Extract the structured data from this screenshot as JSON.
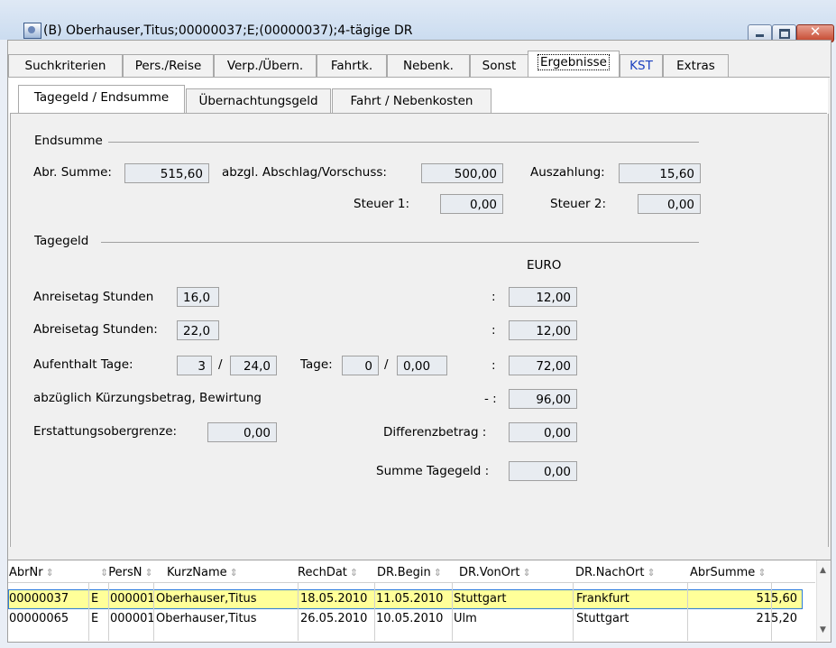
{
  "window": {
    "title": "(B) Oberhauser,Titus;00000037;E;(00000037);4-tägige DR"
  },
  "tabs": [
    "Suchkriterien",
    "Pers./Reise",
    "Verp./Übern.",
    "Fahrtk.",
    "Nebenk.",
    "Sonst",
    "Ergebnisse",
    "KST",
    "Extras"
  ],
  "active_tab": "Ergebnisse",
  "subtabs": [
    "Tagegeld / Endsumme",
    "Übernachtungsgeld",
    "Fahrt / Nebenkosten"
  ],
  "active_subtab": "Tagegeld / Endsumme",
  "endsumme": {
    "header": "Endsumme",
    "abr_summe_label": "Abr. Summe:",
    "abr_summe": "515,60",
    "abschlag_label": "abzgl. Abschlag/Vorschuss:",
    "abschlag": "500,00",
    "auszahlung_label": "Auszahlung:",
    "auszahlung": "15,60",
    "steuer1_label": "Steuer 1:",
    "steuer1": "0,00",
    "steuer2_label": "Steuer 2:",
    "steuer2": "0,00"
  },
  "tagegeld": {
    "header": "Tagegeld",
    "euro_label": "EURO",
    "anreise_label": "Anreisetag Stunden",
    "anreise_hours": "16,0",
    "anreise_amount": "12,00",
    "abreise_label": "Abreisetag Stunden:",
    "abreise_hours": "22,0",
    "abreise_amount": "12,00",
    "aufenthalt_label": "Aufenthalt Tage:",
    "aufenthalt_days": "3",
    "aufenthalt_hours": "24,0",
    "tage_label": "Tage:",
    "tage_days": "0",
    "tage_amount_rate": "0,00",
    "aufenthalt_amount": "72,00",
    "kuerzung_label": "abzüglich Kürzungsbetrag, Bewirtung",
    "kuerzung_sep": "- :",
    "kuerzung_amount": "96,00",
    "erstattung_label": "Erstattungsobergrenze:",
    "erstattung": "0,00",
    "differenz_label": "Differenzbetrag :",
    "differenz": "0,00",
    "summe_label": "Summe Tagegeld :",
    "summe": "0,00",
    "colon": ":",
    "slash": "/"
  },
  "grid": {
    "columns": [
      "AbrNr",
      "PersN",
      "KurzName",
      "RechDat",
      "DR.Begin",
      "DR.VonOrt",
      "DR.NachOrt",
      "AbrSumme"
    ],
    "rows": [
      [
        "00000037",
        "E",
        "000001",
        "Oberhauser,Titus",
        "18.05.2010",
        "11.05.2010",
        "Stuttgart",
        "Frankfurt",
        "515,60"
      ],
      [
        "00000065",
        "E",
        "000001",
        "Oberhauser,Titus",
        "26.05.2010",
        "10.05.2010",
        "Ulm",
        "Stuttgart",
        "215,20"
      ]
    ]
  },
  "colors": {
    "selected_row": "#ffff99",
    "field_bg": "#e8ecf1",
    "active_tab_text": "#1a3fbf"
  }
}
